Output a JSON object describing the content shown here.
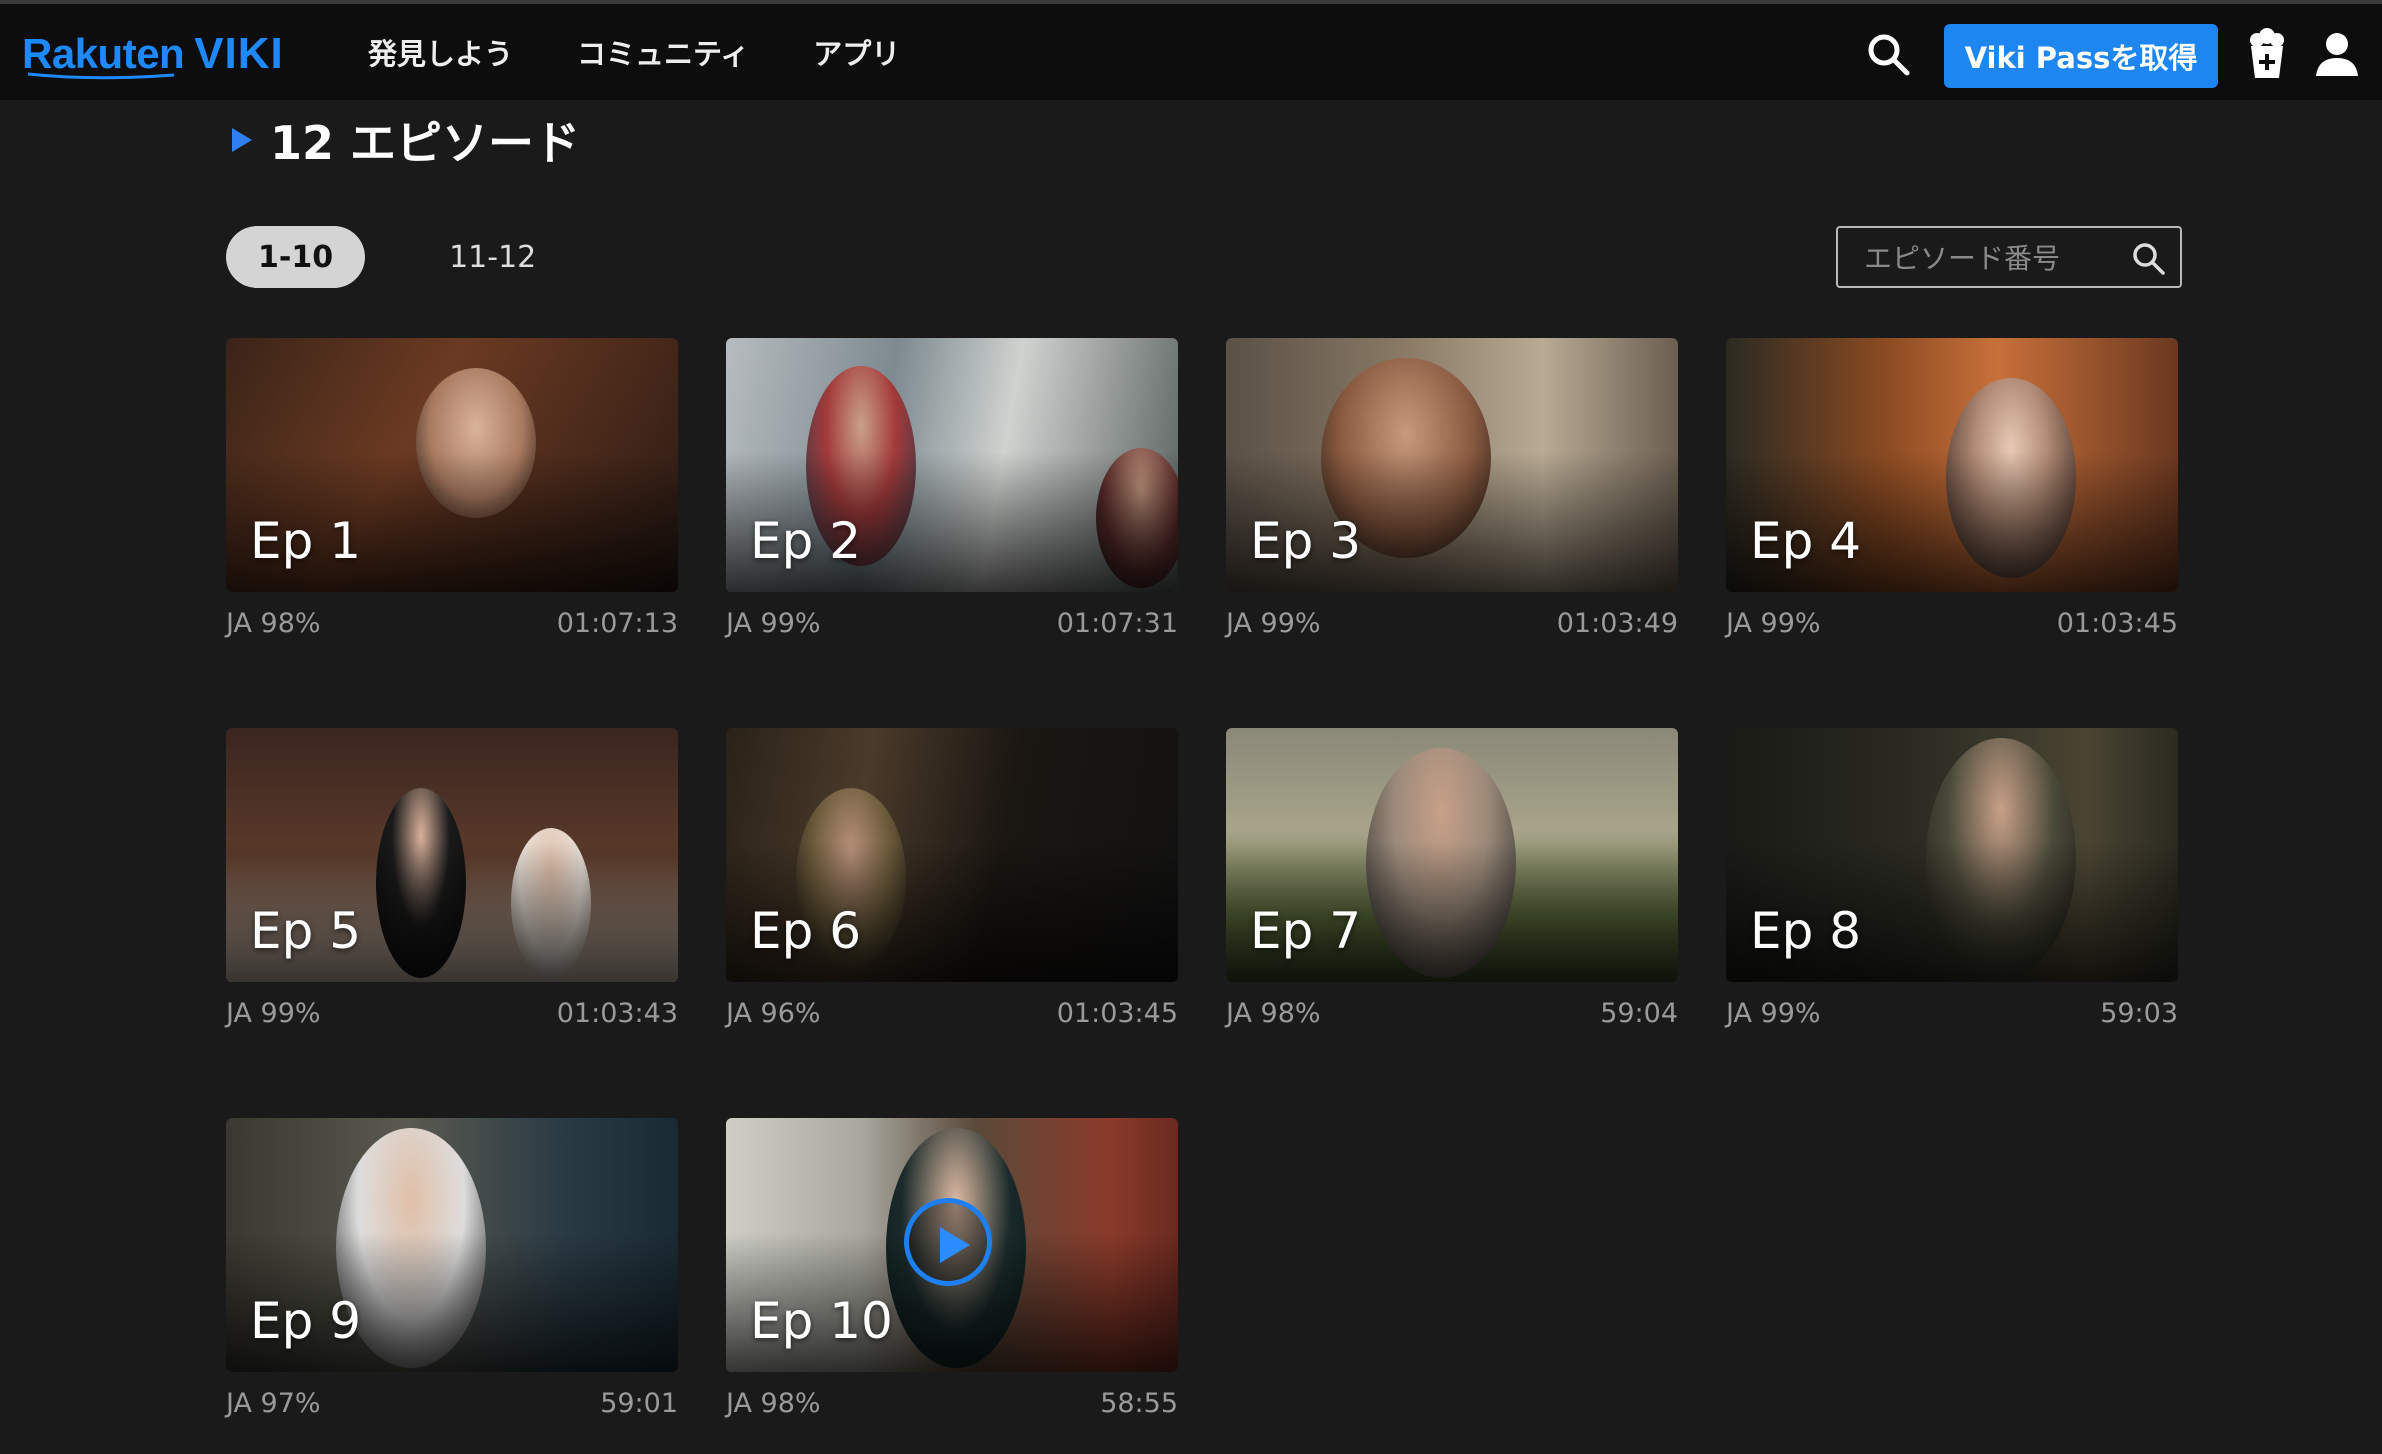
{
  "app": {
    "logo_rakuten": "Rakuten",
    "logo_viki": "VIKI"
  },
  "nav": {
    "items": [
      {
        "label": "発見しよう"
      },
      {
        "label": "コミュニティ"
      },
      {
        "label": "アプリ"
      }
    ],
    "pass_button": "Viki Passを取得"
  },
  "icons": {
    "search": "search-icon",
    "popcorn": "popcorn-icon",
    "user": "user-icon",
    "play": "play-icon"
  },
  "colors": {
    "accent": "#1d86f0",
    "background": "#1a1a1a",
    "header": "#0d0d0d"
  },
  "section": {
    "title": "12 エピソード"
  },
  "range_tabs": [
    {
      "label": "1-10",
      "active": true
    },
    {
      "label": "11-12",
      "active": false
    }
  ],
  "episode_search": {
    "placeholder": "エピソード番号",
    "value": ""
  },
  "episodes": [
    {
      "label": "Ep 1",
      "subs": "JA 98%",
      "duration": "01:07:13"
    },
    {
      "label": "Ep 2",
      "subs": "JA 99%",
      "duration": "01:07:31"
    },
    {
      "label": "Ep 3",
      "subs": "JA 99%",
      "duration": "01:03:49"
    },
    {
      "label": "Ep 4",
      "subs": "JA 99%",
      "duration": "01:03:45"
    },
    {
      "label": "Ep 5",
      "subs": "JA 99%",
      "duration": "01:03:43"
    },
    {
      "label": "Ep 6",
      "subs": "JA 96%",
      "duration": "01:03:45"
    },
    {
      "label": "Ep 7",
      "subs": "JA 98%",
      "duration": "59:04"
    },
    {
      "label": "Ep 8",
      "subs": "JA 99%",
      "duration": "59:03"
    },
    {
      "label": "Ep 9",
      "subs": "JA 97%",
      "duration": "59:01"
    },
    {
      "label": "Ep 10",
      "subs": "JA 98%",
      "duration": "58:55",
      "hover_play": true
    }
  ]
}
